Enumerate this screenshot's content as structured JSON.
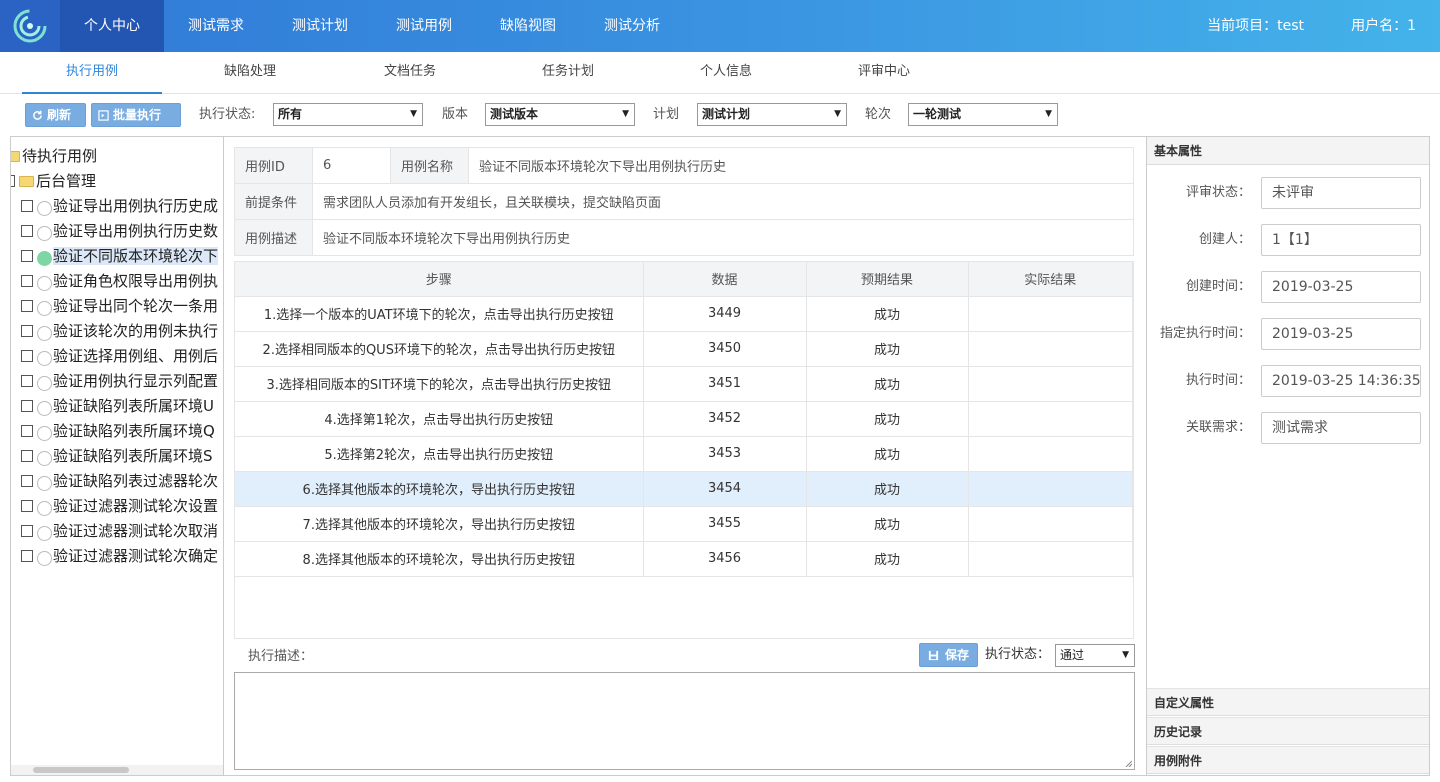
{
  "header": {
    "nav": [
      "个人中心",
      "测试需求",
      "测试计划",
      "测试用例",
      "缺陷视图",
      "测试分析"
    ],
    "project": "当前项目：test",
    "user": "用户名：1"
  },
  "subnav": [
    "执行用例",
    "缺陷处理",
    "文档任务",
    "任务计划",
    "个人信息",
    "评审中心"
  ],
  "toolbar": {
    "refresh": "刷新",
    "batch": "批量执行",
    "status_label": "执行状态:",
    "status_value": "所有",
    "version_label": "版本",
    "version_value": "测试版本",
    "plan_label": "计划",
    "plan_value": "测试计划",
    "round_label": "轮次",
    "round_value": "一轮测试"
  },
  "tree": {
    "root": "待执行用例",
    "group": "后台管理",
    "items": [
      "验证导出用例执行历史成",
      "验证导出用例执行历史数",
      "验证不同版本环境轮次下",
      "验证角色权限导出用例执",
      "验证导出同个轮次一条用",
      "验证该轮次的用例未执行",
      "验证选择用例组、用例后",
      "验证用例执行显示列配置",
      "验证缺陷列表所属环境U",
      "验证缺陷列表所属环境Q",
      "验证缺陷列表所属环境S",
      "验证缺陷列表过滤器轮次",
      "验证过滤器测试轮次设置",
      "验证过滤器测试轮次取消",
      "验证过滤器测试轮次确定"
    ]
  },
  "case": {
    "id_label": "用例ID",
    "id": "6",
    "name_label": "用例名称",
    "name": "验证不同版本环境轮次下导出用例执行历史",
    "pre_label": "前提条件",
    "pre": "需求团队人员添加有开发组长，且关联模块，提交缺陷页面",
    "desc_label": "用例描述",
    "desc": "验证不同版本环境轮次下导出用例执行历史"
  },
  "steps": {
    "headers": [
      "步骤",
      "数据",
      "预期结果",
      "实际结果"
    ],
    "rows": [
      [
        "1.选择一个版本的UAT环境下的轮次，点击导出执行历史按钮",
        "3449",
        "成功",
        ""
      ],
      [
        "2.选择相同版本的QUS环境下的轮次，点击导出执行历史按钮",
        "3450",
        "成功",
        ""
      ],
      [
        "3.选择相同版本的SIT环境下的轮次，点击导出执行历史按钮",
        "3451",
        "成功",
        ""
      ],
      [
        "4.选择第1轮次，点击导出执行历史按钮",
        "3452",
        "成功",
        ""
      ],
      [
        "5.选择第2轮次，点击导出执行历史按钮",
        "3453",
        "成功",
        ""
      ],
      [
        "6.选择其他版本的环境轮次，导出执行历史按钮",
        "3454",
        "成功",
        ""
      ],
      [
        "7.选择其他版本的环境轮次，导出执行历史按钮",
        "3455",
        "成功",
        ""
      ],
      [
        "8.选择其他版本的环境轮次，导出执行历史按钮",
        "3456",
        "成功",
        ""
      ]
    ]
  },
  "exec": {
    "desc_label": "执行描述：",
    "save": "保存",
    "state_label": "执行状态：",
    "state_value": "通过"
  },
  "props": {
    "basic_title": "基本属性",
    "fields": [
      {
        "label": "评审状态：",
        "value": "未评审"
      },
      {
        "label": "创建人：",
        "value": "1【1】"
      },
      {
        "label": "创建时间：",
        "value": "2019-03-25"
      },
      {
        "label": "指定执行时间：",
        "value": "2019-03-25"
      },
      {
        "label": "执行时间：",
        "value": "2019-03-25 14:36:35"
      },
      {
        "label": "关联需求：",
        "value": "测试需求"
      }
    ],
    "custom_title": "自定义属性",
    "history_title": "历史记录",
    "attach_title": "用例附件"
  },
  "colors": {
    "accent": "#2f86d9",
    "header_start": "#2f78d6",
    "header_end": "#44b3ea",
    "success": "#7dd6a3"
  }
}
